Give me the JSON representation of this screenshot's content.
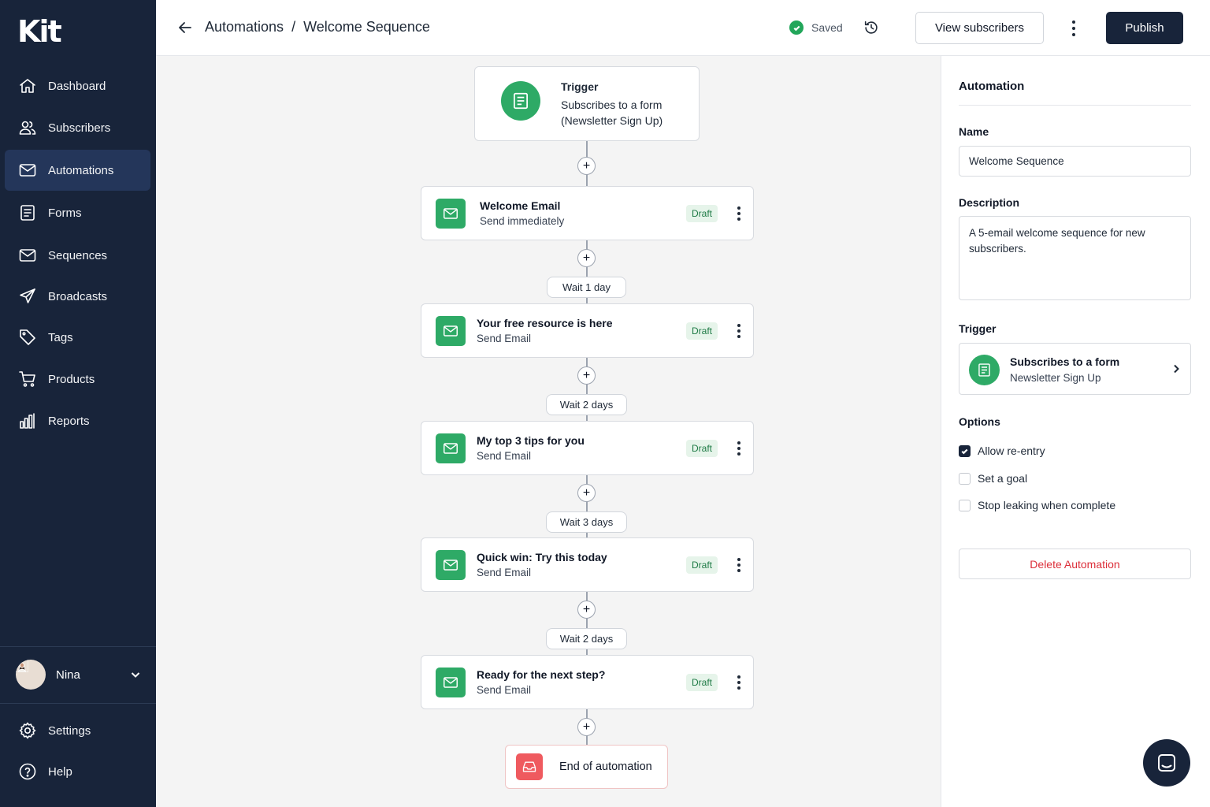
{
  "brand": {
    "logo": "Kit"
  },
  "sidebar": {
    "items": [
      {
        "label": "Dashboard",
        "icon": "home-icon"
      },
      {
        "label": "Subscribers",
        "icon": "users-icon"
      },
      {
        "label": "Automations",
        "icon": "mail-automation-icon",
        "active": true
      },
      {
        "label": "Forms",
        "icon": "form-icon"
      },
      {
        "label": "Sequences",
        "icon": "envelope-icon"
      },
      {
        "label": "Broadcasts",
        "icon": "send-icon"
      },
      {
        "label": "Tags",
        "icon": "tag-icon"
      },
      {
        "label": "Products",
        "icon": "cart-icon"
      },
      {
        "label": "Reports",
        "icon": "bar-chart-icon"
      }
    ],
    "user": {
      "name": "Nina"
    },
    "bottom": [
      {
        "label": "Settings",
        "icon": "gear-icon"
      },
      {
        "label": "Help",
        "icon": "help-icon"
      }
    ]
  },
  "header": {
    "breadcrumb_parent": "Automations",
    "breadcrumb_sep": "/",
    "breadcrumb_current": "Welcome Sequence",
    "saved_label": "Saved",
    "view_subscribers_label": "View subscribers",
    "publish_label": "Publish"
  },
  "flow": {
    "trigger": {
      "title": "Trigger",
      "line1": "Subscribes to a form",
      "line2": "(Newsletter Sign Up)"
    },
    "emails": [
      {
        "title": "Welcome Email",
        "subtitle": "Send immediately",
        "status": "Draft"
      },
      {
        "title": "Your free resource is here",
        "subtitle": "Send Email",
        "status": "Draft"
      },
      {
        "title": "My top 3 tips for you",
        "subtitle": "Send Email",
        "status": "Draft"
      },
      {
        "title": "Quick win: Try this today",
        "subtitle": "Send Email",
        "status": "Draft"
      },
      {
        "title": "Ready for the next step?",
        "subtitle": "Send Email",
        "status": "Draft"
      }
    ],
    "waits": [
      "Wait 1 day",
      "Wait 2 days",
      "Wait 3 days",
      "Wait 2 days"
    ],
    "plus_symbol": "+",
    "end_label": "End of automation"
  },
  "panel": {
    "heading": "Automation",
    "name_label": "Name",
    "name_value": "Welcome Sequence",
    "description_label": "Description",
    "description_value": "A 5-email welcome sequence for new subscribers.",
    "trigger_label": "Trigger",
    "trigger_title": "Subscribes to a form",
    "trigger_sub": "Newsletter Sign Up",
    "options_label": "Options",
    "options": [
      {
        "label": "Allow re-entry",
        "checked": true
      },
      {
        "label": "Set a goal",
        "checked": false
      },
      {
        "label": "Stop leaking when complete",
        "checked": false
      }
    ],
    "delete_label": "Delete Automation"
  },
  "colors": {
    "sidebar_bg": "#18243a",
    "accent_green": "#2eaa66",
    "danger": "#dc2f3a",
    "end_red": "#ef5a5f"
  }
}
